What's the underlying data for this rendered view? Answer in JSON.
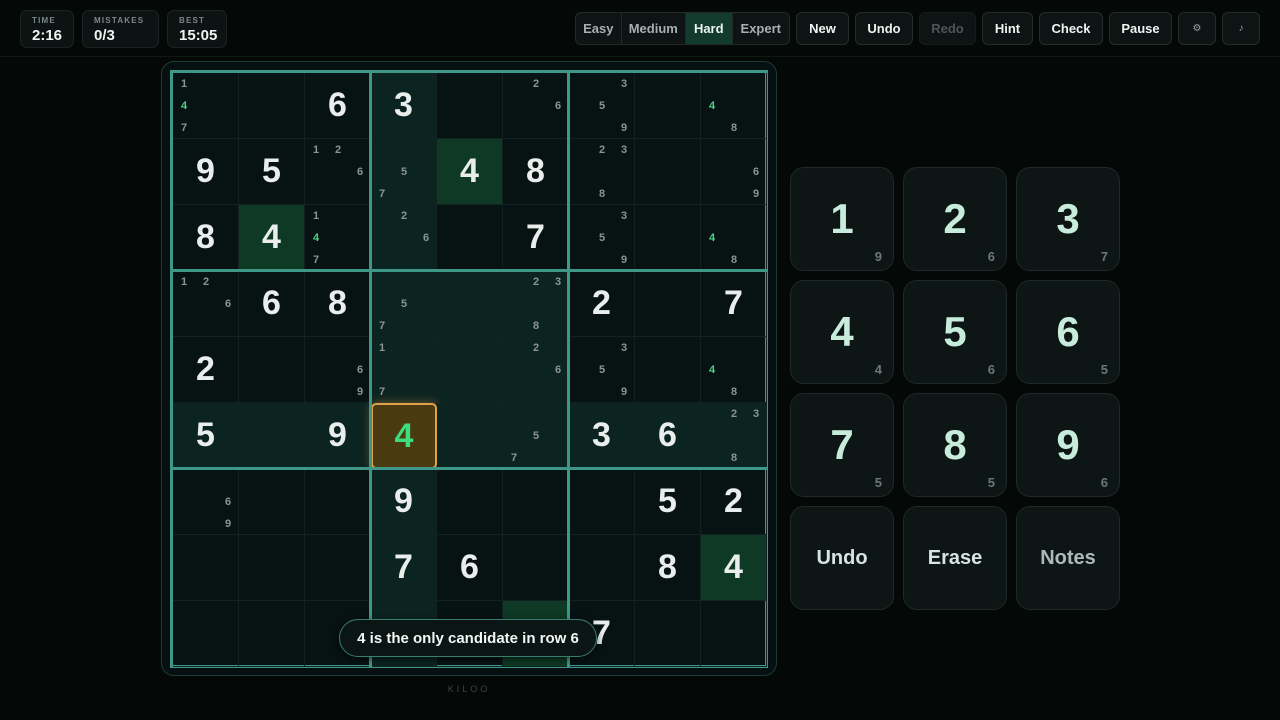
{
  "stats": [
    {
      "label": "TIME",
      "value": "2:16"
    },
    {
      "label": "MISTAKES",
      "value": "0/3"
    },
    {
      "label": "BEST",
      "value": "15:05"
    }
  ],
  "difficulty": {
    "options": [
      "Easy",
      "Medium",
      "Hard",
      "Expert"
    ],
    "selected": "Hard"
  },
  "toolbar": {
    "new_label": "New",
    "undo_label": "Undo",
    "redo_label": "Redo",
    "hint_label": "Hint",
    "check_label": "Check",
    "pause_label": "Pause",
    "settings_icon": "⚙",
    "music_icon": "♪"
  },
  "board": {
    "values": [
      [
        0,
        0,
        6,
        3,
        0,
        0,
        0,
        0,
        0
      ],
      [
        9,
        5,
        0,
        0,
        4,
        8,
        0,
        0,
        0
      ],
      [
        8,
        4,
        0,
        0,
        0,
        7,
        0,
        0,
        0
      ],
      [
        0,
        6,
        8,
        0,
        0,
        0,
        2,
        0,
        7
      ],
      [
        2,
        0,
        0,
        0,
        0,
        0,
        0,
        0,
        0
      ],
      [
        5,
        0,
        9,
        4,
        0,
        0,
        3,
        6,
        0
      ],
      [
        0,
        0,
        0,
        9,
        0,
        0,
        0,
        5,
        2
      ],
      [
        0,
        0,
        0,
        7,
        6,
        0,
        0,
        8,
        4
      ],
      [
        0,
        0,
        0,
        0,
        0,
        0,
        7,
        0,
        0
      ]
    ],
    "notes": [
      [
        [
          1,
          4,
          7
        ],
        [],
        [],
        [],
        [],
        [
          2,
          6
        ],
        [
          3,
          5,
          9
        ],
        [],
        [
          4,
          8
        ]
      ],
      [
        [],
        [],
        [
          1,
          2,
          6
        ],
        [
          5,
          7
        ],
        [],
        [],
        [
          2,
          3,
          8
        ],
        [],
        [
          6,
          9
        ]
      ],
      [
        [],
        [],
        [
          1,
          4,
          7
        ],
        [
          2,
          6
        ],
        [],
        [],
        [
          3,
          5,
          9
        ],
        [],
        [
          4,
          8
        ]
      ],
      [
        [
          1,
          2,
          6
        ],
        [],
        [],
        [
          5,
          7
        ],
        [],
        [
          2,
          3,
          8
        ],
        [],
        [],
        []
      ],
      [
        [],
        [],
        [
          6,
          9
        ],
        [
          1,
          7
        ],
        [],
        [
          2,
          6
        ],
        [
          3,
          5,
          9
        ],
        [],
        [
          4,
          8
        ]
      ],
      [
        [],
        [],
        [],
        [],
        [],
        [
          5,
          7
        ],
        [],
        [],
        [
          2,
          3,
          8
        ]
      ],
      [
        [
          6,
          9
        ],
        [],
        [],
        [],
        [],
        [],
        [],
        [],
        []
      ],
      [
        [],
        [],
        [],
        [],
        [],
        [],
        [],
        [],
        []
      ],
      [
        [],
        [],
        [],
        [],
        [],
        [],
        [],
        [],
        []
      ]
    ],
    "green_notes": [
      [
        0,
        0,
        4
      ],
      [
        0,
        8,
        4
      ],
      [
        2,
        2,
        4
      ],
      [
        2,
        8,
        4
      ],
      [
        4,
        8,
        4
      ]
    ],
    "selected_cell": [
      5,
      3
    ],
    "highlight_row": 5,
    "highlight_col": 3,
    "same_value_cells": [
      [
        1,
        4
      ],
      [
        2,
        1
      ],
      [
        7,
        8
      ],
      [
        8,
        5
      ]
    ]
  },
  "toast": "4 is the only candidate in row 6",
  "brand": "KILOO",
  "keypad": {
    "numbers": [
      {
        "num": "1",
        "remaining": "9"
      },
      {
        "num": "2",
        "remaining": "6"
      },
      {
        "num": "3",
        "remaining": "7"
      },
      {
        "num": "4",
        "remaining": "4"
      },
      {
        "num": "5",
        "remaining": "6"
      },
      {
        "num": "6",
        "remaining": "5"
      },
      {
        "num": "7",
        "remaining": "5"
      },
      {
        "num": "8",
        "remaining": "5"
      },
      {
        "num": "9",
        "remaining": "6"
      }
    ],
    "actions": [
      "Undo",
      "Erase",
      "Notes"
    ]
  },
  "colors": {
    "accent": "#3f9887",
    "selected_border": "#e0a14a",
    "green_digit": "#3ddc7f"
  }
}
